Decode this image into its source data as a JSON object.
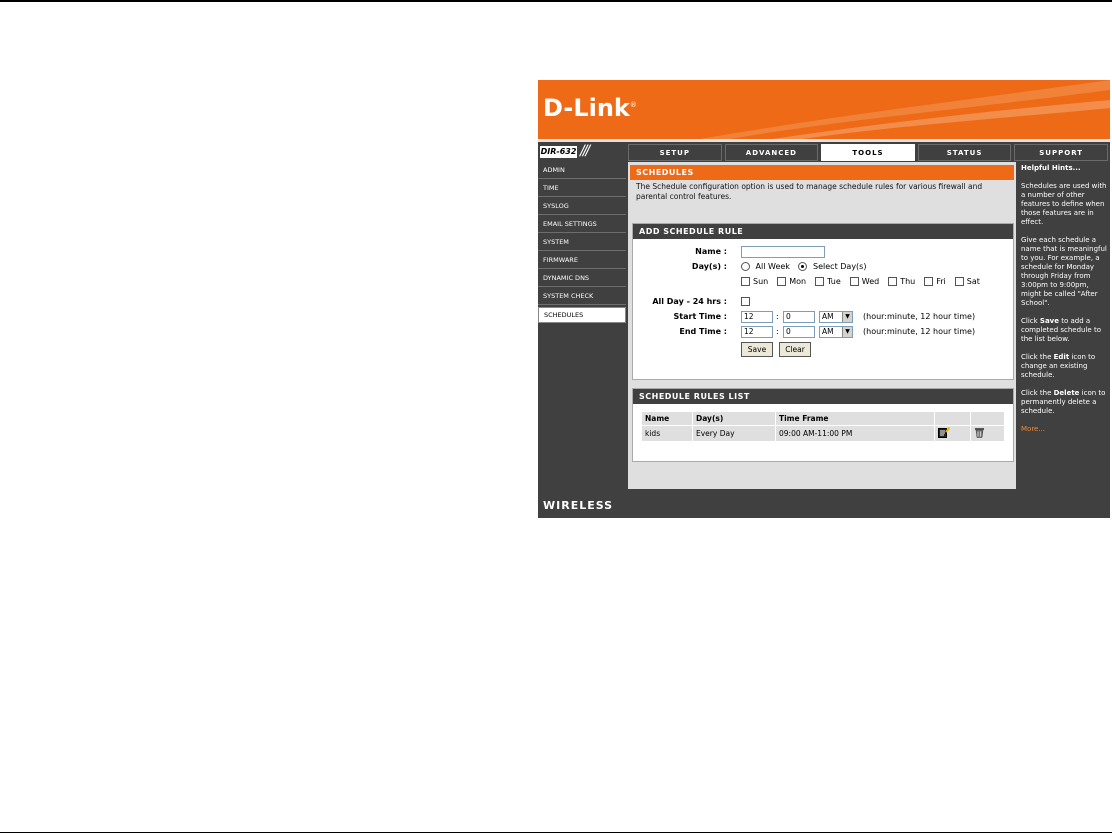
{
  "brand": {
    "logo": "D-Link",
    "model": "DIR-632",
    "footer": "WIRELESS"
  },
  "tabs": [
    "SETUP",
    "ADVANCED",
    "TOOLS",
    "STATUS",
    "SUPPORT"
  ],
  "active_tab": "TOOLS",
  "sidebar": [
    "ADMIN",
    "TIME",
    "SYSLOG",
    "EMAIL SETTINGS",
    "SYSTEM",
    "FIRMWARE",
    "DYNAMIC DNS",
    "SYSTEM CHECK",
    "SCHEDULES"
  ],
  "active_sidebar": "SCHEDULES",
  "intro": {
    "title": "SCHEDULES",
    "text": "The Schedule configuration option is used to manage schedule rules for various firewall and parental control features."
  },
  "add_rule": {
    "title": "ADD SCHEDULE RULE",
    "name_label": "Name :",
    "name_value": "",
    "days_label": "Day(s) :",
    "all_week": "All Week",
    "select_days": "Select Day(s)",
    "day_names": [
      "Sun",
      "Mon",
      "Tue",
      "Wed",
      "Thu",
      "Fri",
      "Sat"
    ],
    "all_day_label": "All Day - 24 hrs :",
    "start_label": "Start Time :",
    "end_label": "End Time :",
    "start_hour": "12",
    "start_min": "0",
    "start_ampm": "AM",
    "end_hour": "12",
    "end_min": "0",
    "end_ampm": "AM",
    "colon": ":",
    "time_hint": "(hour:minute, 12 hour time)",
    "save": "Save",
    "clear": "Clear"
  },
  "rules_list": {
    "title": "SCHEDULE RULES LIST",
    "headers": [
      "Name",
      "Day(s)",
      "Time Frame"
    ],
    "rows": [
      {
        "name": "kids",
        "days": "Every Day",
        "time": "09:00 AM-11:00 PM"
      }
    ]
  },
  "hints": {
    "title": "Helpful Hints...",
    "p1": "Schedules are used with a number of other features to define when those features are in effect.",
    "p2": "Give each schedule a name that is meaningful to you. For example, a schedule for Monday through Friday from 3:00pm to 9:00pm, might be called \"After School\".",
    "p3a": "Click ",
    "p3b": "Save",
    "p3c": " to add a completed schedule to the list below.",
    "p4a": "Click the ",
    "p4b": "Edit",
    "p4c": " icon to change an existing schedule.",
    "p5a": "Click the ",
    "p5b": "Delete",
    "p5c": " icon to permanently delete a schedule.",
    "more": "More..."
  },
  "colors": {
    "orange": "#ee6a17",
    "dark": "#404040",
    "panel": "#dfdfdf"
  }
}
